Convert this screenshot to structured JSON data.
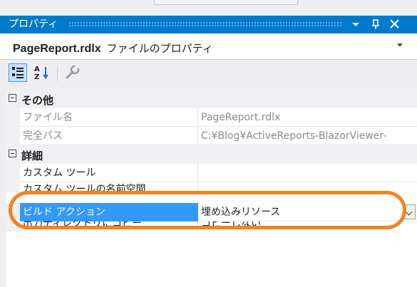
{
  "title_bar": {
    "title": "プロパティ",
    "buttons": [
      "dropdown-arrow-icon",
      "pin-icon",
      "close-icon"
    ]
  },
  "object_selector": {
    "name": "PageReport.rdlx",
    "type": "ファイルのプロパティ"
  },
  "toolbar": {
    "buttons": [
      "categorized-icon",
      "alphabetical-icon",
      "property-pages-icon"
    ]
  },
  "grid": {
    "categories": [
      {
        "label": "その他",
        "properties": [
          {
            "name": "ファイル名",
            "value": "PageReport.rdlx"
          },
          {
            "name": "完全パス",
            "value": "C:¥Blog¥ActiveReports-BlazorViewer-"
          }
        ]
      },
      {
        "label": "詳細",
        "properties": [
          {
            "name": "カスタム ツール",
            "value": ""
          },
          {
            "name": "カスタム ツールの名前空間",
            "value": ""
          },
          {
            "name": "ビルド アクション",
            "value": "埋め込みリソース"
          },
          {
            "name": "出力ディレクトリにコピー",
            "value": "コピーしない"
          }
        ]
      }
    ]
  },
  "colors": {
    "accent": "#007acc",
    "selection": "#3399ff",
    "highlight_ring": "#f58220"
  }
}
